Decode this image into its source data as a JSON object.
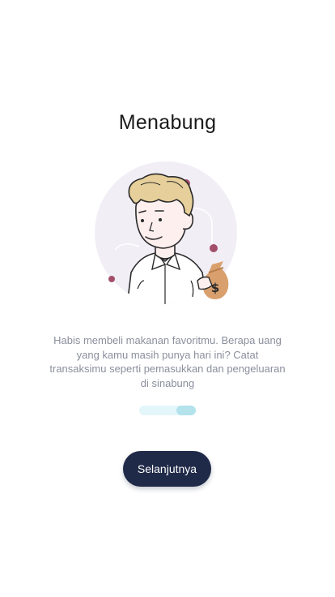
{
  "onboarding": {
    "title": "Menabung",
    "description": "Habis membeli makanan favoritmu. Berapa uang yang kamu masih punya hari ini? Catat transaksimu seperti pemasukkan dan pengeluaran di sinabung",
    "next_label": "Selanjutnya",
    "illustration_icon": "man-with-money-bag-icon",
    "money_symbol": "$",
    "pager": {
      "total_pages": 2,
      "active_page": 2
    }
  },
  "colors": {
    "title": "#1a1a1a",
    "description": "#8b8f9c",
    "button_bg": "#1f2a48",
    "button_text": "#ffffff",
    "pager_track": "#e3f7fb",
    "pager_active": "#b4e3ec",
    "illustration_circle": "#f1eef6",
    "hair": "#e6cf9a",
    "money_bag": "#d9a06d",
    "accent_dot": "#a34f6a"
  }
}
